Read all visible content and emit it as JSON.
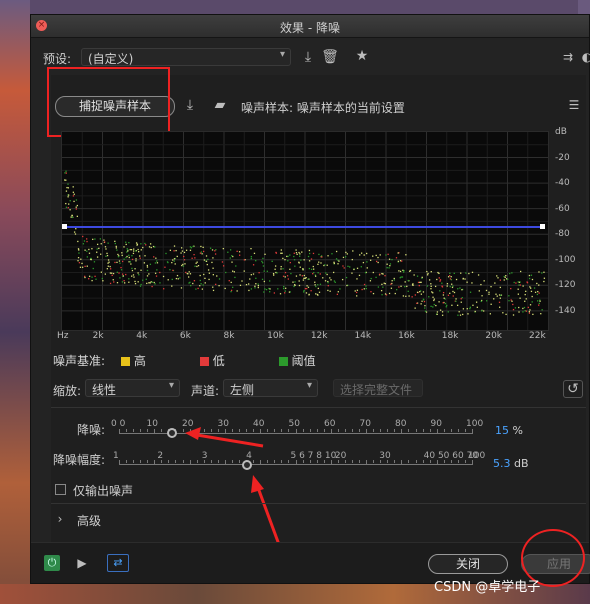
{
  "window": {
    "title": "效果 - 降噪"
  },
  "preset": {
    "label": "预设:",
    "value": "(自定义)"
  },
  "capture": {
    "button_label": "捕捉噪声样本",
    "sample_text": "噪声样本: 噪声样本的当前设置"
  },
  "graph": {
    "db_ticks": [
      "dB",
      "-20",
      "-40",
      "-60",
      "-80",
      "-100",
      "-120",
      "-140"
    ],
    "hz_ticks": [
      "Hz",
      "2k",
      "4k",
      "6k",
      "8k",
      "10k",
      "12k",
      "14k",
      "16k",
      "18k",
      "20k",
      "22k"
    ]
  },
  "legend": {
    "label": "噪声基准:",
    "items": [
      {
        "label": "高",
        "color": "#e8c21a"
      },
      {
        "label": "低",
        "color": "#e23a3a"
      },
      {
        "label": "阈值",
        "color": "#2c9a2c"
      }
    ]
  },
  "controls": {
    "zoom_label": "缩放:",
    "zoom_value": "线性",
    "channel_label": "声道:",
    "channel_value": "左侧",
    "select_file_label": "选择完整文件"
  },
  "denoise": {
    "label": "降噪:",
    "ticks": [
      "0 0",
      "10",
      "20",
      "30",
      "40",
      "50",
      "60",
      "70",
      "80",
      "90",
      "100"
    ],
    "value": "15",
    "unit": "%",
    "fraction": 0.15
  },
  "amplitude": {
    "label": "降噪幅度:",
    "ticks": [
      "1",
      "2",
      "3",
      "4",
      "5 6 7 8 10",
      "20",
      "30",
      "40 50 60 70",
      "100"
    ],
    "value": "5.3",
    "unit": "dB"
  },
  "output_noise_only": {
    "label": "仅输出噪声"
  },
  "advanced": {
    "label": "高级"
  },
  "buttons": {
    "close": "关闭",
    "apply": "应用"
  },
  "watermark": "CSDN @卓学电子"
}
